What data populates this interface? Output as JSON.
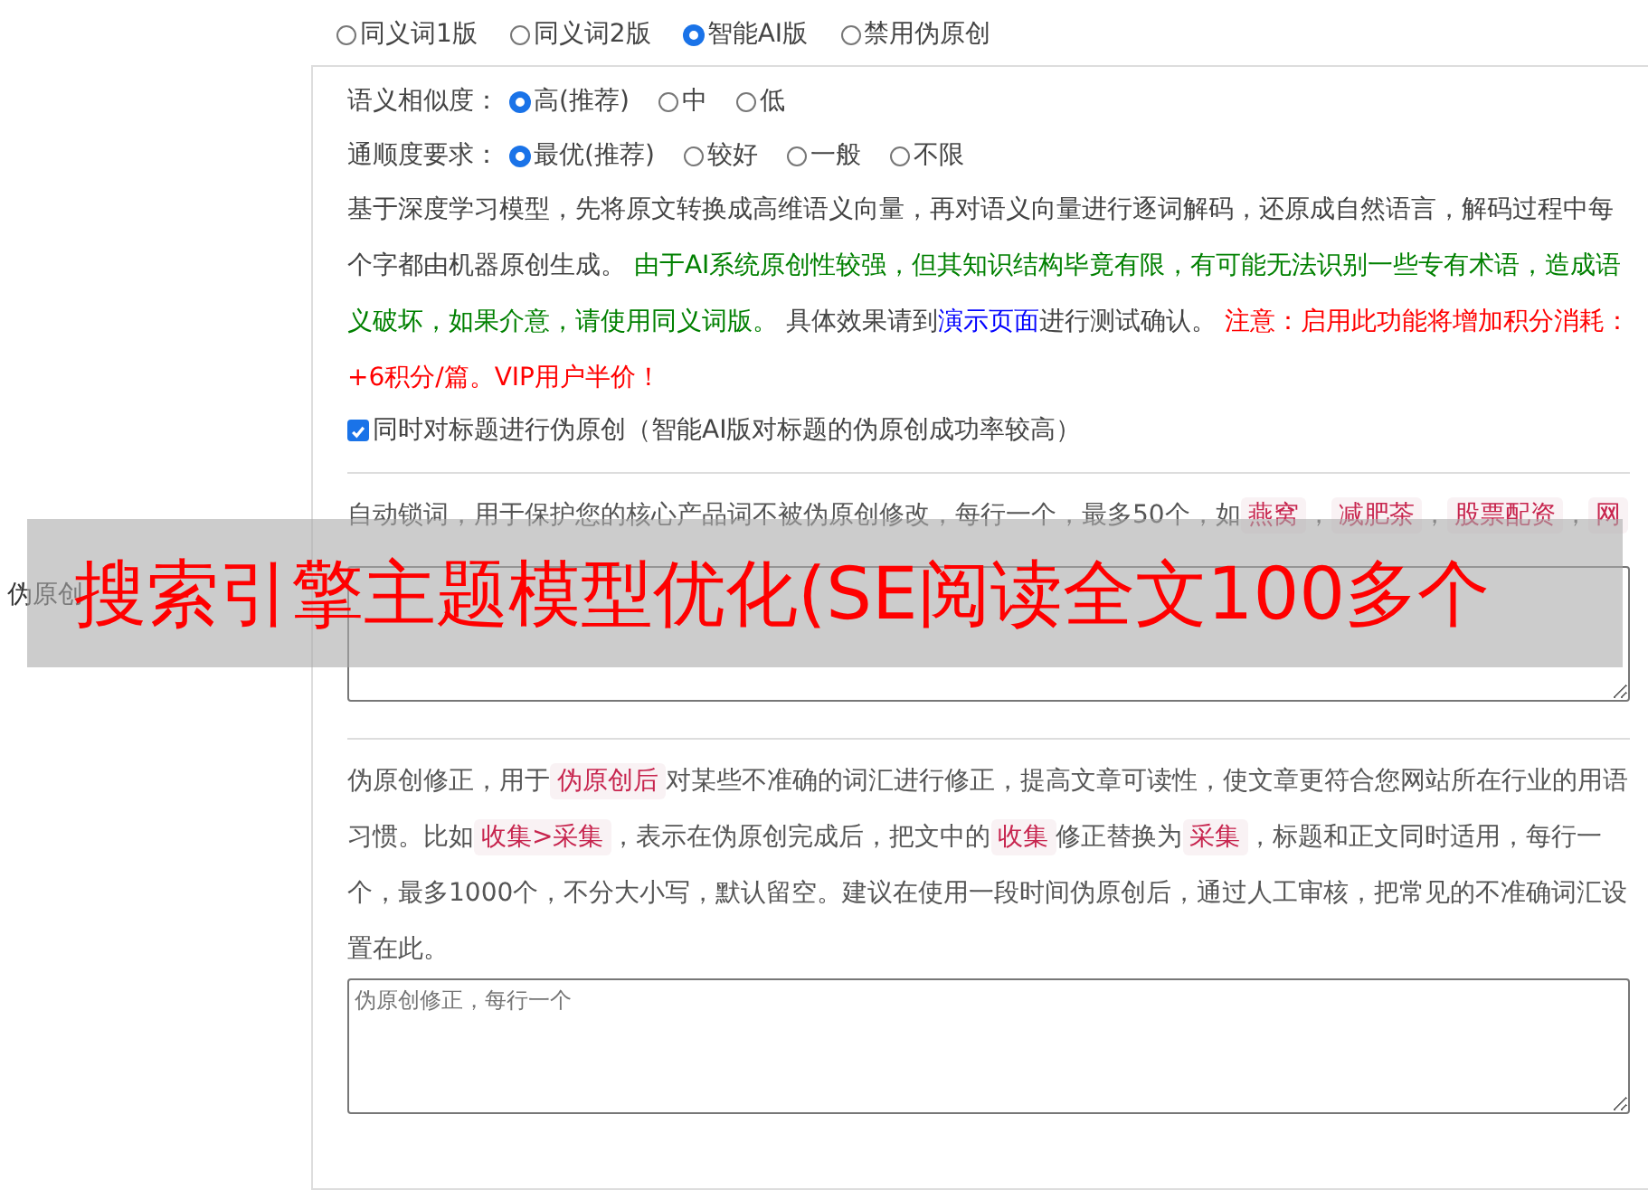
{
  "side_label": "伪原创",
  "mode_options": [
    {
      "label": "同义词1版",
      "selected": false
    },
    {
      "label": "同义词2版",
      "selected": false
    },
    {
      "label": "智能AI版",
      "selected": true
    },
    {
      "label": "禁用伪原创",
      "selected": false
    }
  ],
  "settings": [
    {
      "label": "语义相似度：",
      "options": [
        {
          "label": "高(推荐)",
          "selected": true
        },
        {
          "label": "中",
          "selected": false
        },
        {
          "label": "低",
          "selected": false
        }
      ]
    },
    {
      "label": "通顺度要求：",
      "options": [
        {
          "label": "最优(推荐)",
          "selected": true
        },
        {
          "label": "较好",
          "selected": false
        },
        {
          "label": "一般",
          "selected": false
        },
        {
          "label": "不限",
          "selected": false
        }
      ]
    }
  ],
  "ai_description": [
    {
      "kind": "text",
      "text": "基于深度学习模型，先将原文转换成高维语义向量，再对语义向量进行逐词解码，还原成自然语言，解码过程中每个字都由机器原创生成。 "
    },
    {
      "kind": "green",
      "text": "由于AI系统原创性较强，但其知识结构毕竟有限，有可能无法识别一些专有术语，造成语义破坏，如果介意，请使用同义词版。"
    },
    {
      "kind": "text",
      "text": " 具体效果请到"
    },
    {
      "kind": "link",
      "text": "演示页面"
    },
    {
      "kind": "text",
      "text": "进行测试确认。 "
    },
    {
      "kind": "red",
      "text": "注意：启用此功能将增加积分消耗：+6积分/篇。VIP用户半价！"
    }
  ],
  "title_checkbox": {
    "label": "同时对标题进行伪原创（智能AI版对标题的伪原创成功率较高）",
    "checked": true
  },
  "auto_lock": {
    "description": [
      {
        "kind": "text",
        "text": "自动锁词，用于保护您的核心产品词不被伪原创修改，每行一个，最多50个，如"
      },
      {
        "kind": "tag",
        "text": "燕窝"
      },
      {
        "kind": "text",
        "text": "，"
      },
      {
        "kind": "tag",
        "text": "减肥茶"
      },
      {
        "kind": "text",
        "text": "，"
      },
      {
        "kind": "tag",
        "text": "股票配资"
      },
      {
        "kind": "text",
        "text": "，"
      },
      {
        "kind": "tag",
        "text": "网"
      }
    ]
  },
  "correction": {
    "description": [
      {
        "kind": "text",
        "text": "伪原创修正，用于"
      },
      {
        "kind": "tag",
        "text": "伪原创后"
      },
      {
        "kind": "text",
        "text": "对某些不准确的词汇进行修正，提高文章可读性，使文章更符合您网站所在行业的用语习惯。比如"
      },
      {
        "kind": "tag",
        "text": "收集>采集"
      },
      {
        "kind": "text",
        "text": "，表示在伪原创完成后，把文中的"
      },
      {
        "kind": "tag",
        "text": "收集"
      },
      {
        "kind": "text",
        "text": "修正替换为"
      },
      {
        "kind": "tag",
        "text": "采集"
      },
      {
        "kind": "text",
        "text": "，标题和正文同时适用，每行一个，最多1000个，不分大小写，默认留空。建议在使用一段时间伪原创后，通过人工审核，把常见的不准确词汇设置在此。"
      }
    ],
    "placeholder": "伪原创修正，每行一个"
  },
  "overlay_banner": "搜索引擎主题模型优化(SE阅读全文100多个"
}
